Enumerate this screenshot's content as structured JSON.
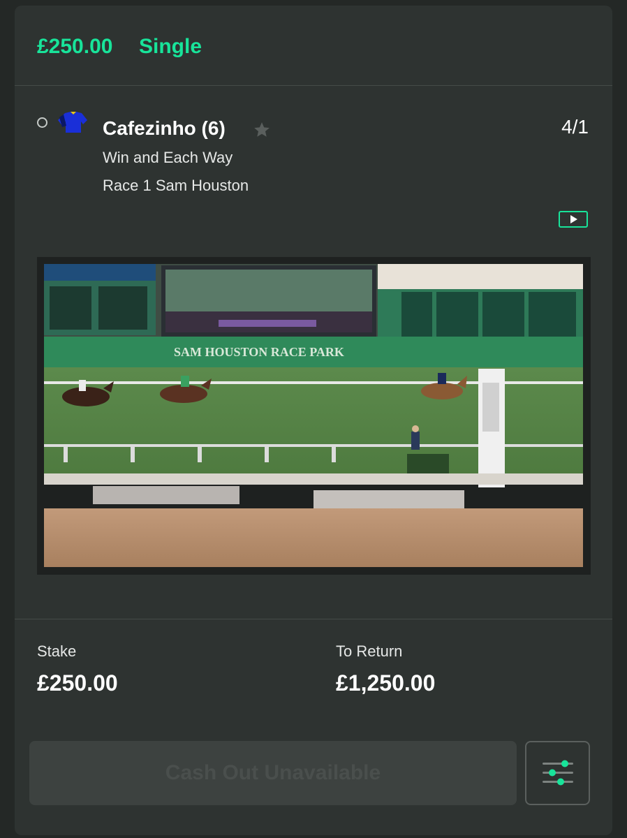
{
  "bet": {
    "amount": "£250.00",
    "type": "Single"
  },
  "selection": {
    "name": "Cafezinho (6)",
    "odds": "4/1",
    "market": "Win and Each Way",
    "event": "Race 1 Sam Houston",
    "favourite_icon": "star-icon",
    "status_icon": "radio-circle-icon",
    "silks_icon": "jockey-silks-icon",
    "stream_icon": "play-icon"
  },
  "video": {
    "signage": "SAM HOUSTON RACE PARK"
  },
  "totals": {
    "stake_label": "Stake",
    "stake_value": "£250.00",
    "return_label": "To Return",
    "return_value": "£1,250.00"
  },
  "actions": {
    "cashout_label": "Cash Out Unavailable",
    "settings_icon": "sliders-icon"
  },
  "colors": {
    "accent": "#18e49a",
    "background": "#242826",
    "card": "#2e3331",
    "silks_blue": "#1a2fd8"
  }
}
